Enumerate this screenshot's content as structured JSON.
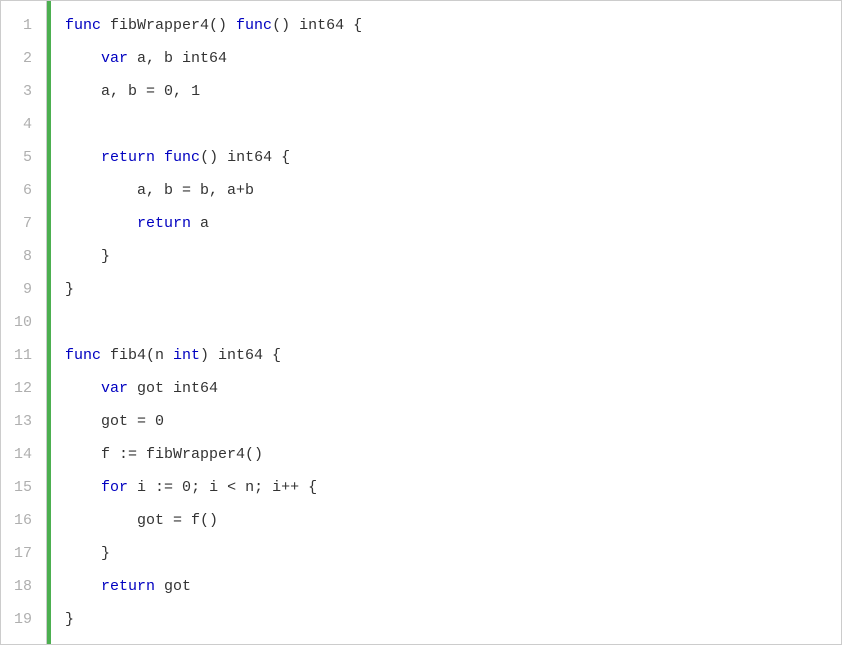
{
  "lines": {
    "n1": "1",
    "n2": "2",
    "n3": "3",
    "n4": "4",
    "n5": "5",
    "n6": "6",
    "n7": "7",
    "n8": "8",
    "n9": "9",
    "n10": "10",
    "n11": "11",
    "n12": "12",
    "n13": "13",
    "n14": "14",
    "n15": "15",
    "n16": "16",
    "n17": "17",
    "n18": "18",
    "n19": "19"
  },
  "code": {
    "l1": {
      "kw_func1": "func",
      "name": " fibWrapper4() ",
      "kw_func2": "func",
      "rest": "() int64 {"
    },
    "l2": {
      "indent": "    ",
      "kw_var": "var",
      "rest": " a, b int64"
    },
    "l3": {
      "indent": "    ",
      "lhs": "a, b = ",
      "v0": "0",
      "comma": ", ",
      "v1": "1"
    },
    "l4": {
      "blank": ""
    },
    "l5": {
      "indent": "    ",
      "kw_return": "return",
      "sp": " ",
      "kw_func": "func",
      "rest": "() int64 {"
    },
    "l6": {
      "indent": "        ",
      "rest": "a, b = b, a+b"
    },
    "l7": {
      "indent": "        ",
      "kw_return": "return",
      "rest": " a"
    },
    "l8": {
      "indent": "    ",
      "brace": "}"
    },
    "l9": {
      "brace": "}"
    },
    "l10": {
      "blank": ""
    },
    "l11": {
      "kw_func": "func",
      "name": " fib4(n ",
      "kw_int": "int",
      "rest": ") int64 {"
    },
    "l12": {
      "indent": "    ",
      "kw_var": "var",
      "rest": " got int64"
    },
    "l13": {
      "indent": "    ",
      "lhs": "got = ",
      "val": "0"
    },
    "l14": {
      "indent": "    ",
      "rest": "f := fibWrapper4()"
    },
    "l15": {
      "indent": "    ",
      "kw_for": "for",
      "a": " i := ",
      "zero": "0",
      "b": "; i < n; i++ {"
    },
    "l16": {
      "indent": "        ",
      "rest": "got = f()"
    },
    "l17": {
      "indent": "    ",
      "brace": "}"
    },
    "l18": {
      "indent": "    ",
      "kw_return": "return",
      "rest": " got"
    },
    "l19": {
      "brace": "}"
    }
  }
}
